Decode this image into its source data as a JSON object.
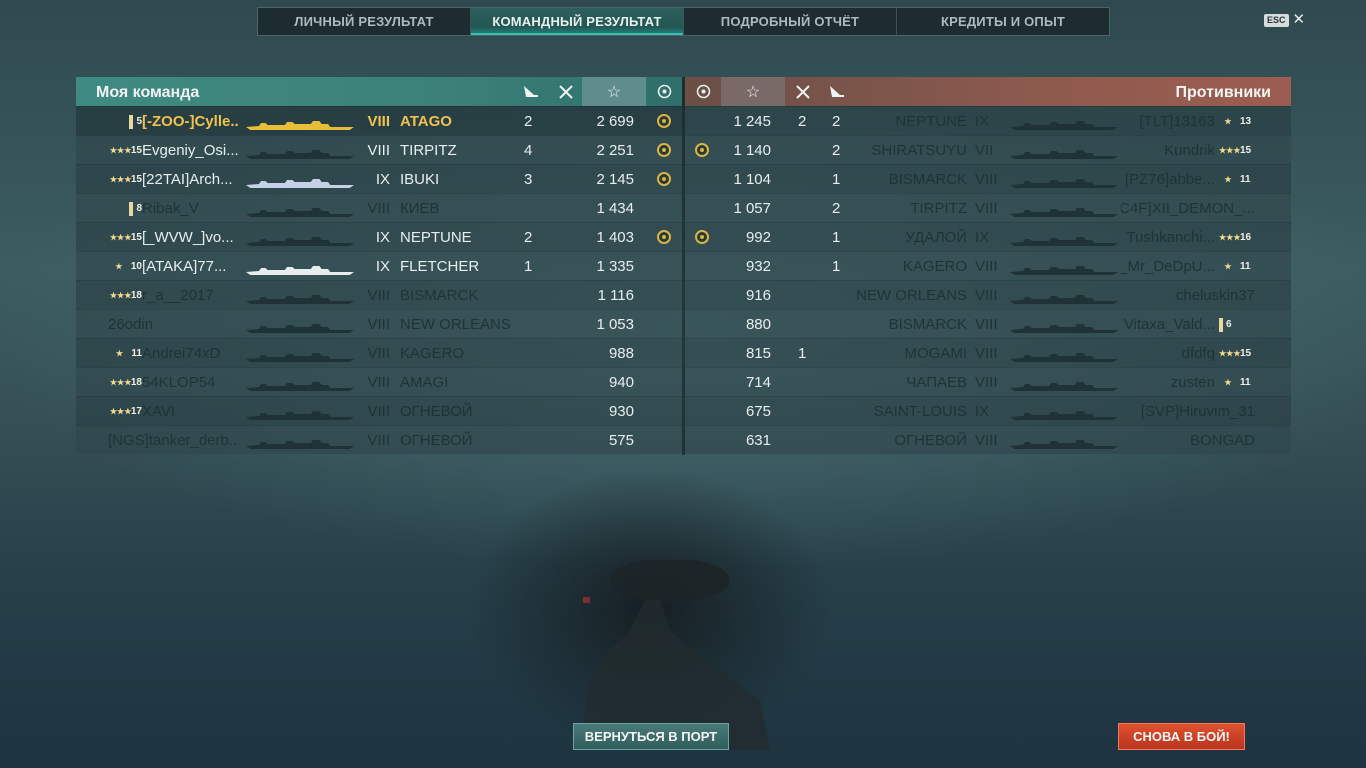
{
  "tabs": [
    {
      "label": "ЛИЧНЫЙ РЕЗУЛЬТАТ",
      "active": false
    },
    {
      "label": "КОМАНДНЫЙ РЕЗУЛЬТАТ",
      "active": true
    },
    {
      "label": "ПОДРОБНЫЙ ОТЧЁТ",
      "active": false
    },
    {
      "label": "КРЕДИТЫ И ОПЫТ",
      "active": false
    }
  ],
  "esc_label": "ESC",
  "my_team": {
    "title": "Моя команда",
    "rows": [
      {
        "rank": "5",
        "player": "[-ZOO-]Cylle...",
        "tier": "VIII",
        "ship": "ATAGO",
        "kills": "2",
        "xp": "2 699",
        "badge": true,
        "mine": true
      },
      {
        "rank": "15",
        "player": "Evgeniy_Osi...",
        "tier": "VIII",
        "ship": "TIRPITZ",
        "kills": "4",
        "xp": "2 251",
        "badge": true
      },
      {
        "rank": "15",
        "player": "[22TAI]Arch...",
        "tier": "IX",
        "ship": "IBUKI",
        "kills": "3",
        "xp": "2 145",
        "badge": true
      },
      {
        "rank": "8",
        "player": "Ribak_V",
        "tier": "VIII",
        "ship": "КИЕВ",
        "kills": "",
        "xp": "1 434",
        "badge": false
      },
      {
        "rank": "15",
        "player": "[_WVW_]vo...",
        "tier": "IX",
        "ship": "NEPTUNE",
        "kills": "2",
        "xp": "1 403",
        "badge": true
      },
      {
        "rank": "10",
        "player": "[ATAKA]77...",
        "tier": "IX",
        "ship": "FLETCHER",
        "kills": "1",
        "xp": "1 335",
        "badge": false
      },
      {
        "rank": "18",
        "player": "r_a__2017",
        "tier": "VIII",
        "ship": "BISMARCK",
        "kills": "",
        "xp": "1 116",
        "badge": false
      },
      {
        "rank": "",
        "player": "26odin",
        "tier": "VIII",
        "ship": "NEW ORLEANS",
        "kills": "",
        "xp": "1 053",
        "badge": false
      },
      {
        "rank": "11",
        "player": "Andrei74xD",
        "tier": "VIII",
        "ship": "KAGERO",
        "kills": "",
        "xp": "988",
        "badge": false
      },
      {
        "rank": "18",
        "player": "54KLOP54",
        "tier": "VIII",
        "ship": "AMAGI",
        "kills": "",
        "xp": "940",
        "badge": false
      },
      {
        "rank": "17",
        "player": "XAVI",
        "tier": "VIII",
        "ship": "ОГНЕВОЙ",
        "kills": "",
        "xp": "930",
        "badge": false
      },
      {
        "rank": "",
        "player": "[NGS]tanker_derb...",
        "tier": "VIII",
        "ship": "ОГНЕВОЙ",
        "kills": "",
        "xp": "575",
        "badge": false
      }
    ]
  },
  "enemy_team": {
    "title": "Противники",
    "rows": [
      {
        "badge": false,
        "xp": "1 245",
        "planes": "2",
        "kills": "2",
        "ship": "NEPTUNE",
        "tier": "IX",
        "player": "[TLT]13163",
        "rank": "13"
      },
      {
        "badge": true,
        "xp": "1 140",
        "planes": "",
        "kills": "2",
        "ship": "SHIRATSUYU",
        "tier": "VII",
        "player": "Kundrik",
        "rank": "15"
      },
      {
        "badge": false,
        "xp": "1 104",
        "planes": "",
        "kills": "1",
        "ship": "BISMARCK",
        "tier": "VIII",
        "player": "[PZ76]abbe...",
        "rank": "11"
      },
      {
        "badge": false,
        "xp": "1 057",
        "planes": "",
        "kills": "2",
        "ship": "TIRPITZ",
        "tier": "VIII",
        "player": "[C4F]XII_DEMON_...",
        "rank": ""
      },
      {
        "badge": true,
        "xp": "992",
        "planes": "",
        "kills": "1",
        "ship": "УДАЛОЙ",
        "tier": "IX",
        "player": "Tushkanchi...",
        "rank": "16"
      },
      {
        "badge": false,
        "xp": "932",
        "planes": "",
        "kills": "1",
        "ship": "KAGERO",
        "tier": "VIII",
        "player": "_Mr_DeDpU...",
        "rank": "11"
      },
      {
        "badge": false,
        "xp": "916",
        "planes": "",
        "kills": "",
        "ship": "NEW ORLEANS",
        "tier": "VIII",
        "player": "cheluskin37",
        "rank": ""
      },
      {
        "badge": false,
        "xp": "880",
        "planes": "",
        "kills": "",
        "ship": "BISMARCK",
        "tier": "VIII",
        "player": "Vitaxa_Vald...",
        "rank": "6"
      },
      {
        "badge": false,
        "xp": "815",
        "planes": "1",
        "kills": "",
        "ship": "MOGAMI",
        "tier": "VIII",
        "player": "dfdfq",
        "rank": "15"
      },
      {
        "badge": false,
        "xp": "714",
        "planes": "",
        "kills": "",
        "ship": "ЧАПАЕВ",
        "tier": "VIII",
        "player": "zusten",
        "rank": "11"
      },
      {
        "badge": false,
        "xp": "675",
        "planes": "",
        "kills": "",
        "ship": "SAINT-LOUIS",
        "tier": "IX",
        "player": "[SVP]Hiruvim_31",
        "rank": ""
      },
      {
        "badge": false,
        "xp": "631",
        "planes": "",
        "kills": "",
        "ship": "ОГНЕВОЙ",
        "tier": "VIII",
        "player": "BONGAD",
        "rank": ""
      }
    ]
  },
  "buttons": {
    "port": "ВЕРНУТЬСЯ В ПОРТ",
    "again": "СНОВА В БОЙ!"
  },
  "colors": {
    "ally_header": "#3f8a82",
    "enemy_header": "#9c5d50",
    "player_highlight": "#f2c24e",
    "battle_button": "#c93f23"
  }
}
